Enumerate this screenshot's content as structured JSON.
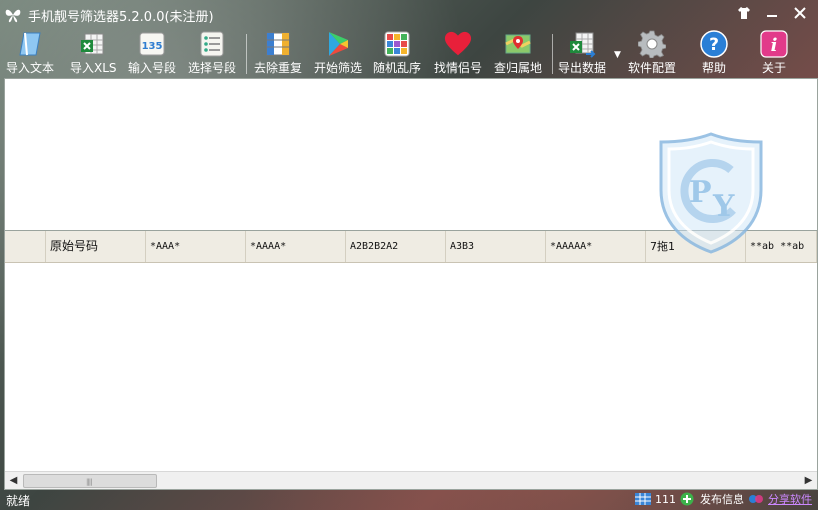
{
  "window": {
    "title": "手机靓号筛选器5.2.0.0(未注册)"
  },
  "toolbar": {
    "items": [
      {
        "label": "导入文本",
        "icon": "notepad-icon"
      },
      {
        "label": "导入XLS",
        "icon": "excel-icon"
      },
      {
        "label": "输入号段",
        "icon": "number-135-icon"
      },
      {
        "label": "选择号段",
        "icon": "list-icon"
      },
      {
        "label": "去除重复",
        "icon": "dedupe-icon"
      },
      {
        "label": "开始筛选",
        "icon": "play-icon"
      },
      {
        "label": "随机乱序",
        "icon": "shuffle-icon"
      },
      {
        "label": "找情侣号",
        "icon": "heart-icon"
      },
      {
        "label": "查归属地",
        "icon": "map-icon"
      },
      {
        "label": "导出数据",
        "icon": "export-excel-icon"
      },
      {
        "label": "软件配置",
        "icon": "gear-icon"
      },
      {
        "label": "帮助",
        "icon": "help-icon"
      },
      {
        "label": "关于",
        "icon": "info-icon"
      }
    ]
  },
  "grid": {
    "columns": [
      "原始号码",
      "*AAA*",
      "*AAAA*",
      "A2B2B2A2",
      "A3B3",
      "*AAAAA*",
      "7拖1",
      "**ab **ab"
    ]
  },
  "watermark": {
    "letters": "PCY"
  },
  "status": {
    "text": "就绪",
    "count": "111",
    "publish_label": "发布信息",
    "share_label": "分享软件"
  },
  "colors": {
    "heart": "#e8203a",
    "help": "#2a7fd6",
    "info": "#e23a8a"
  }
}
